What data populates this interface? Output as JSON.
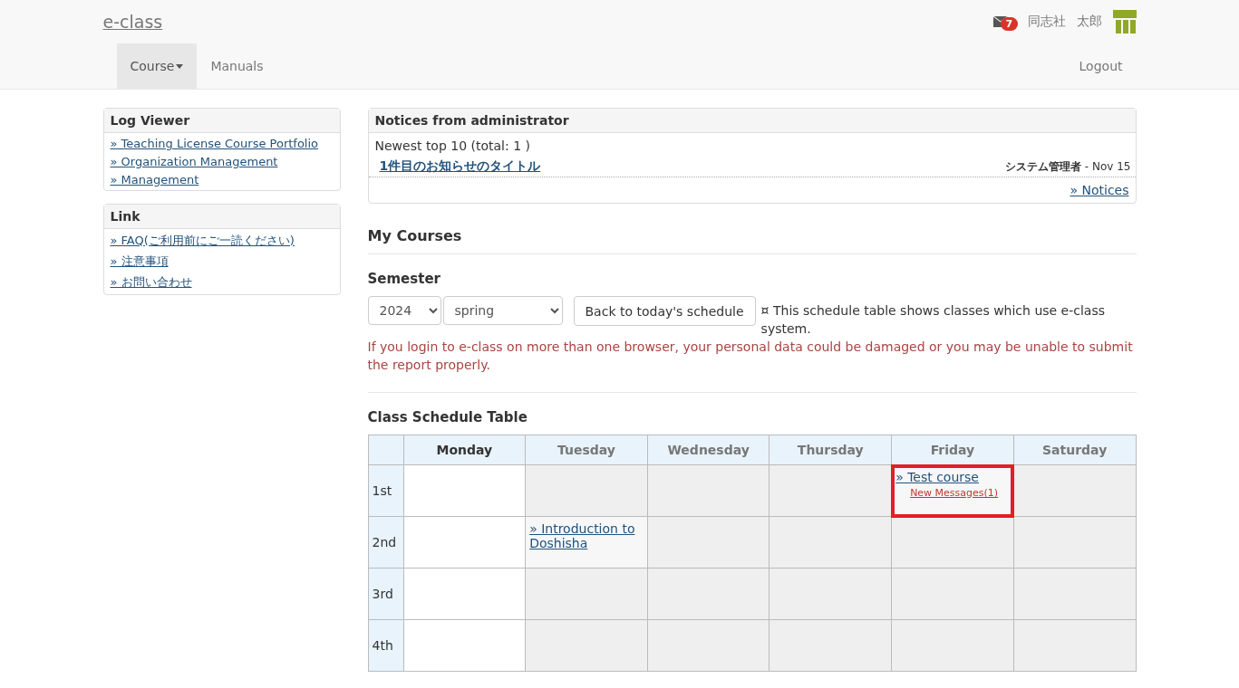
{
  "header": {
    "logo": "e-class",
    "mail_badge": "7",
    "user_org": "同志社",
    "user_name": "太郎"
  },
  "nav": {
    "items": [
      {
        "label": "Course",
        "selected": true,
        "dropdown": true
      },
      {
        "label": "Manuals",
        "selected": false,
        "dropdown": false
      }
    ],
    "logout": "Logout"
  },
  "sidebar": [
    {
      "title": "Log Viewer",
      "links": [
        "» Teaching License Course Portfolio",
        "» Organization Management",
        "» Management"
      ]
    },
    {
      "title": "Link",
      "links": [
        "» FAQ(ご利用前にご一読ください)",
        "» 注意事項",
        "» お問い合わせ"
      ]
    }
  ],
  "notices": {
    "title": "Notices from administrator",
    "summary": "Newest top 10 (total: 1 )",
    "items": [
      {
        "title": "1件目のお知らせのタイトル",
        "author": "システム管理者",
        "date": " - Nov 15"
      }
    ],
    "more_link": "» Notices"
  },
  "my_courses": {
    "title": "My Courses",
    "semester_label": "Semester",
    "year": "2024",
    "term": "spring",
    "back_button": "Back to today's schedule",
    "info": "¤ This schedule table shows classes which use e-class system.",
    "warning": "If you login to e-class on more than one browser, your personal data could be damaged or you may be unable to submit the report properly."
  },
  "schedule": {
    "title": "Class Schedule Table",
    "days": [
      {
        "label": "Monday",
        "selected": true
      },
      {
        "label": "Tuesday",
        "selected": false
      },
      {
        "label": "Wednesday",
        "selected": false
      },
      {
        "label": "Thursday",
        "selected": false
      },
      {
        "label": "Friday",
        "selected": false
      },
      {
        "label": "Saturday",
        "selected": false
      }
    ],
    "periods": [
      {
        "label": "1st",
        "cells": [
          {
            "kind": "empty"
          },
          {
            "kind": "empty"
          },
          {
            "kind": "empty"
          },
          {
            "kind": "empty"
          },
          {
            "kind": "course",
            "course": "» Test course",
            "messages": "New Messages(1)",
            "highlighted": true
          },
          {
            "kind": "empty"
          }
        ]
      },
      {
        "label": "2nd",
        "cells": [
          {
            "kind": "empty"
          },
          {
            "kind": "course",
            "course": "» Introduction to Doshisha",
            "highlighted": false
          },
          {
            "kind": "empty"
          },
          {
            "kind": "empty"
          },
          {
            "kind": "empty"
          },
          {
            "kind": "empty"
          }
        ]
      },
      {
        "label": "3rd",
        "cells": [
          {
            "kind": "empty"
          },
          {
            "kind": "empty"
          },
          {
            "kind": "empty"
          },
          {
            "kind": "empty"
          },
          {
            "kind": "empty"
          },
          {
            "kind": "empty"
          }
        ]
      },
      {
        "label": "4th",
        "cells": [
          {
            "kind": "empty"
          },
          {
            "kind": "empty"
          },
          {
            "kind": "empty"
          },
          {
            "kind": "empty"
          },
          {
            "kind": "empty"
          },
          {
            "kind": "empty"
          }
        ]
      }
    ]
  }
}
